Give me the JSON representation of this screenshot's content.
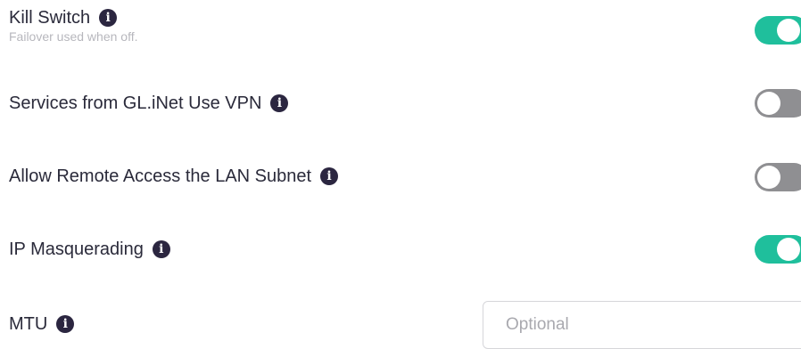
{
  "settings": {
    "kill_switch": {
      "label": "Kill Switch",
      "description": "Failover used when off.",
      "info_icon": "info-circle",
      "state": "on"
    },
    "services_use_vpn": {
      "label": "Services from GL.iNet Use VPN",
      "info_icon": "info-circle",
      "state": "off"
    },
    "remote_access_lan": {
      "label": "Allow Remote Access the LAN Subnet",
      "info_icon": "info-circle",
      "state": "off"
    },
    "ip_masquerading": {
      "label": "IP Masquerading",
      "info_icon": "info-circle",
      "state": "on"
    },
    "mtu": {
      "label": "MTU",
      "info_icon": "info-circle",
      "value": "",
      "placeholder": "Optional"
    }
  },
  "icons": {
    "info_glyph": "i"
  },
  "colors": {
    "toggle_on": "#1fbf9c",
    "toggle_off": "#8f8f92",
    "info_icon_bg": "#2b2640",
    "sublabel": "#b7b7bd"
  }
}
